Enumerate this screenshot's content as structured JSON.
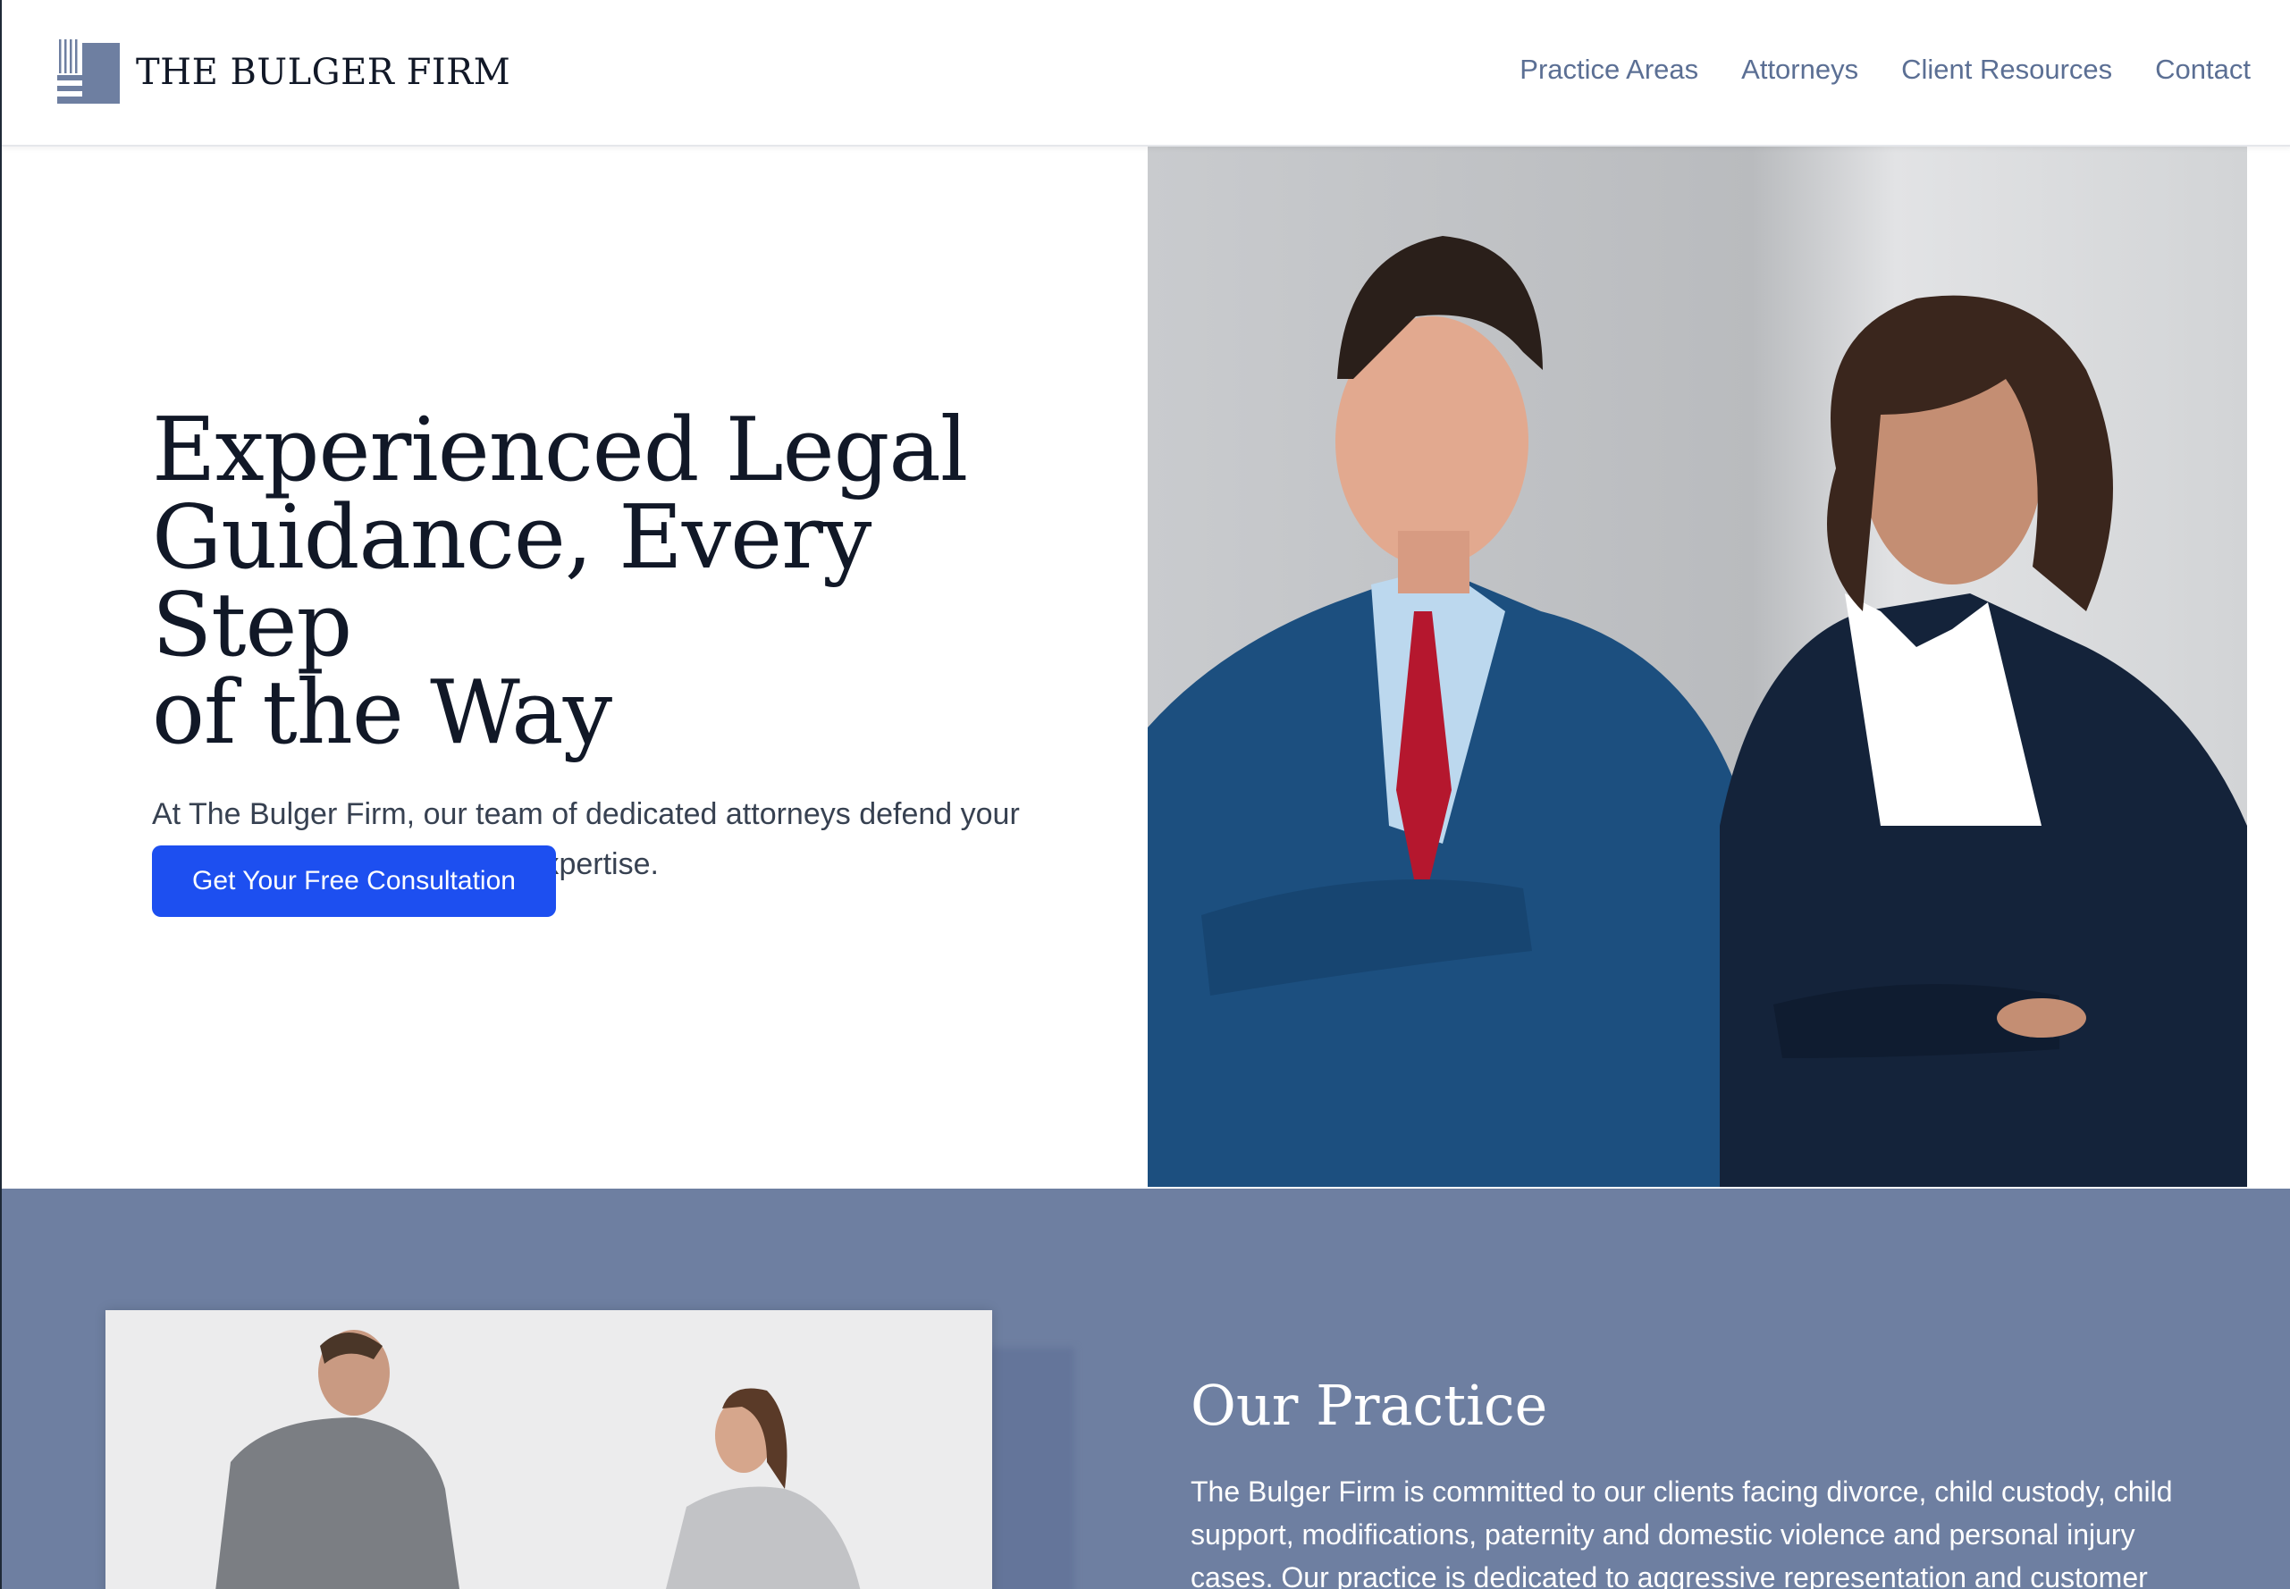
{
  "header": {
    "logo_text": "THE BULGER FIRM",
    "nav": [
      "Practice Areas",
      "Attorneys",
      "Client Resources",
      "Contact"
    ]
  },
  "hero": {
    "title_lines": [
      "Experienced Legal",
      "Guidance, Every Step",
      "of the Way"
    ],
    "subtitle": "At The Bulger Firm, our team of dedicated attorneys defend your rights with compassion and expertise.",
    "cta": "Get Your Free Consultation"
  },
  "practice": {
    "title": "Our Practice",
    "body": "The Bulger Firm is committed to our clients facing divorce, child custody, child support, modifications, paternity and domestic violence and personal injury cases. Our practice is dedicated to aggressive representation and customer"
  },
  "colors": {
    "accent": "#1d4ff0",
    "brand_slate": "#6e7fa1",
    "nav_text": "#5b6f94",
    "heading": "#111827"
  },
  "icons": {
    "logo": "columns-building-icon"
  }
}
